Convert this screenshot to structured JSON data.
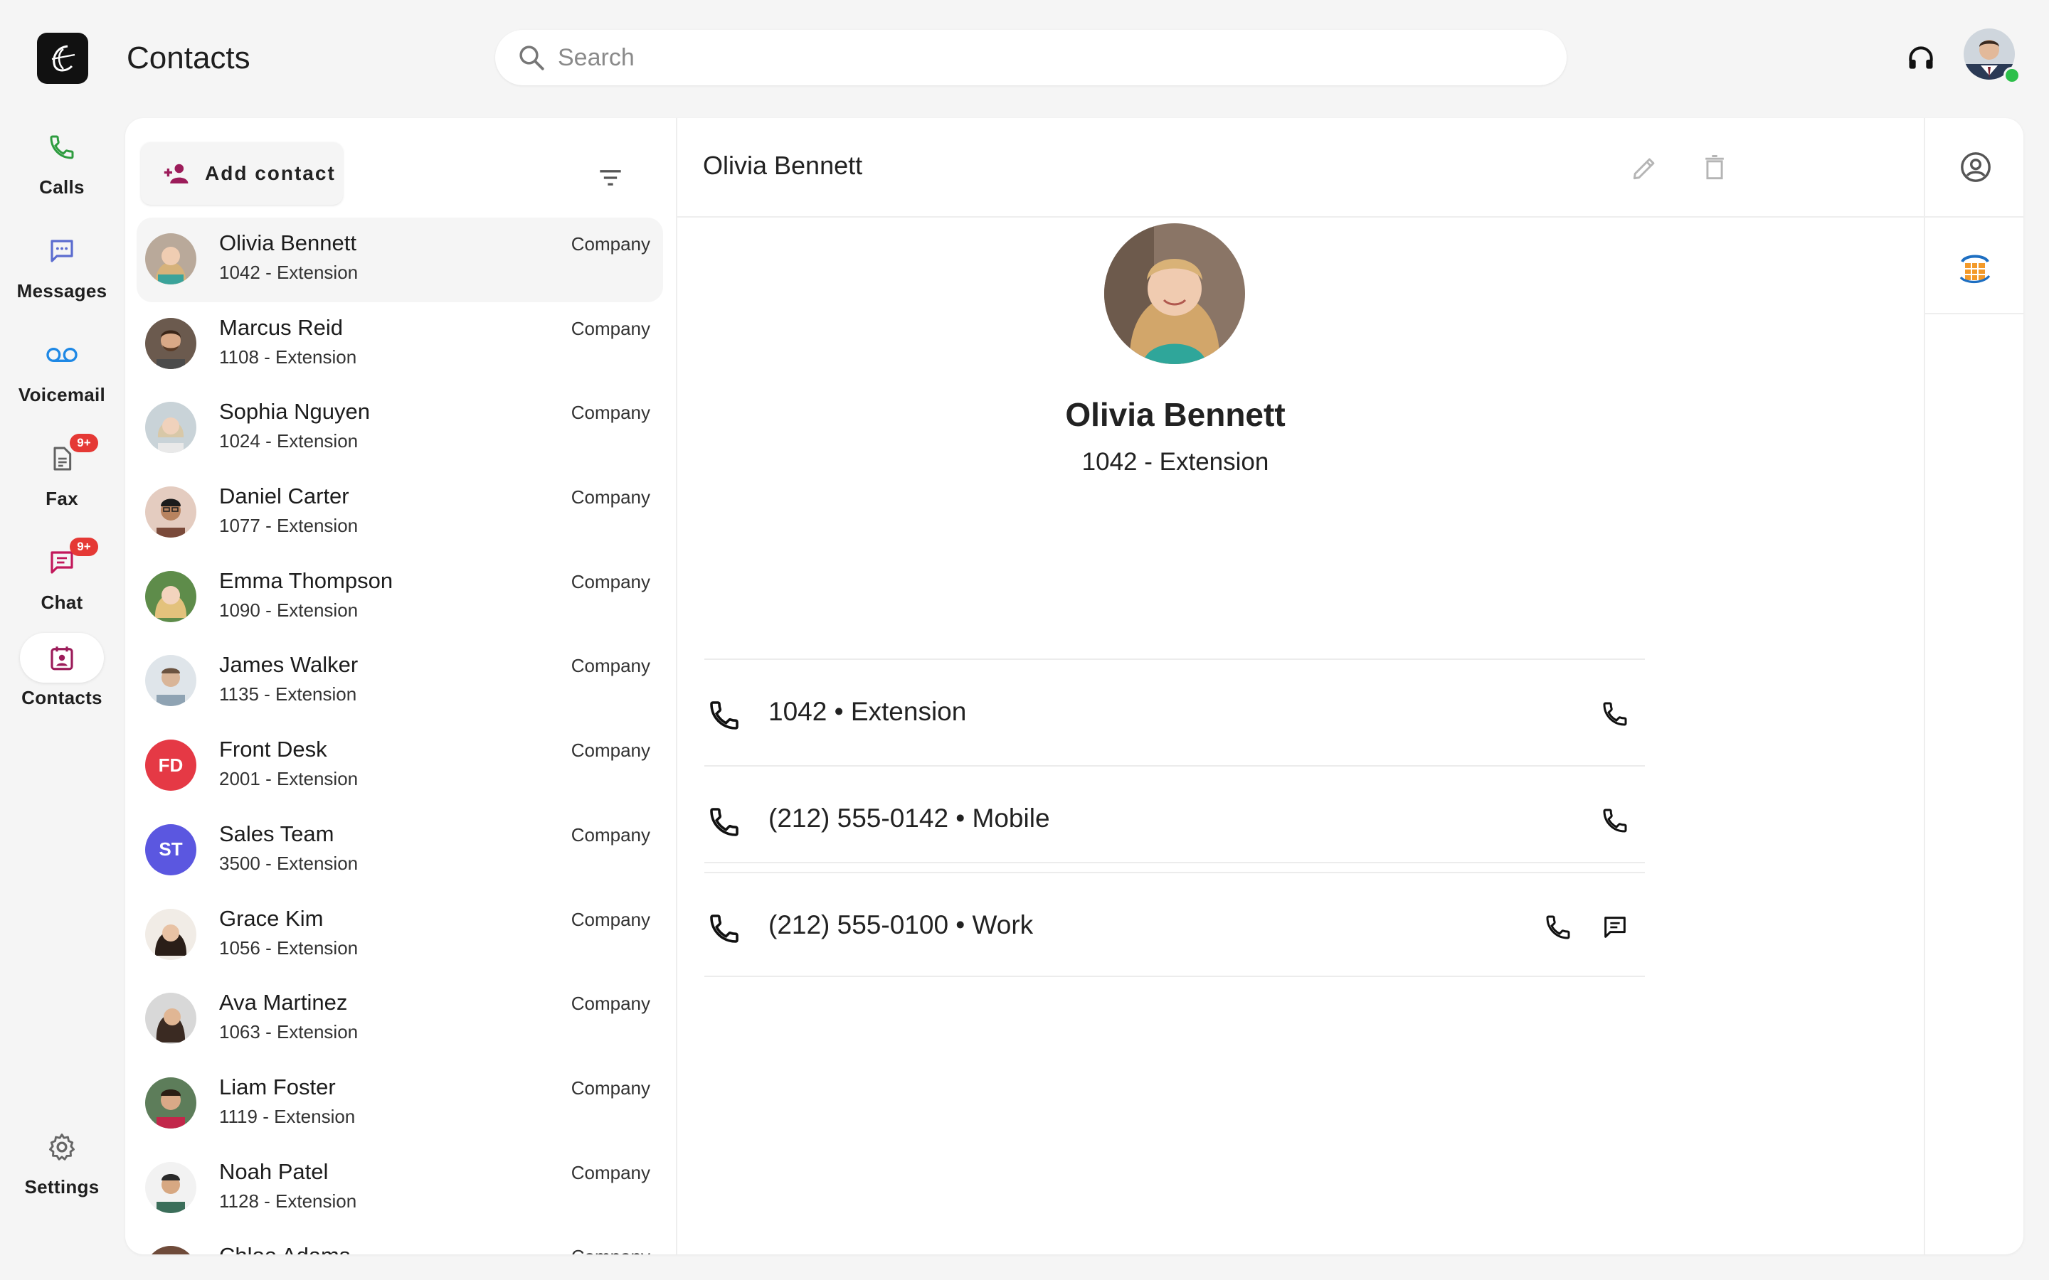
{
  "app": {
    "title": "Contacts"
  },
  "search": {
    "placeholder": "Search"
  },
  "nav": [
    {
      "label": "Calls",
      "icon": "phone-icon",
      "color": "#2e9c3f"
    },
    {
      "label": "Messages",
      "icon": "message-icon",
      "color": "#5b6ccf"
    },
    {
      "label": "Voicemail",
      "icon": "voicemail-icon",
      "color": "#1e88e5"
    },
    {
      "label": "Fax",
      "icon": "fax-icon",
      "color": "#616161",
      "badge": "9+"
    },
    {
      "label": "Chat",
      "icon": "chat-icon",
      "color": "#c2185b",
      "badge": "9+"
    },
    {
      "label": "Contacts",
      "icon": "contacts-icon",
      "color": "#9c1c5a",
      "active": true
    }
  ],
  "settings": {
    "label": "Settings"
  },
  "list": {
    "add_label": "Add contact",
    "contacts": [
      {
        "name": "Olivia Bennett",
        "ext": "1042 - Extension",
        "company": "Company",
        "selected": true
      },
      {
        "name": "Marcus Reid",
        "ext": "1108 - Extension",
        "company": "Company"
      },
      {
        "name": "Sophia Nguyen",
        "ext": "1024 - Extension",
        "company": "Company"
      },
      {
        "name": "Daniel Carter",
        "ext": "1077 - Extension",
        "company": "Company"
      },
      {
        "name": "Emma Thompson",
        "ext": "1090 - Extension",
        "company": "Company"
      },
      {
        "name": "James Walker",
        "ext": "1135 - Extension",
        "company": "Company"
      },
      {
        "name": "Front Desk",
        "ext": "2001 - Extension",
        "company": "Company",
        "initials": "FD",
        "color": "#e53945"
      },
      {
        "name": "Sales Team",
        "ext": "3500 - Extension",
        "company": "Company",
        "initials": "ST",
        "color": "#5b57e0"
      },
      {
        "name": "Grace Kim",
        "ext": "1056 - Extension",
        "company": "Company"
      },
      {
        "name": "Ava Martinez",
        "ext": "1063 - Extension",
        "company": "Company"
      },
      {
        "name": "Liam Foster",
        "ext": "1119 - Extension",
        "company": "Company"
      },
      {
        "name": "Noah Patel",
        "ext": "1128 - Extension",
        "company": "Company"
      },
      {
        "name": "Chloe Adams",
        "ext": "",
        "company": "Company"
      }
    ]
  },
  "detail": {
    "header_name": "Olivia Bennett",
    "name": "Olivia Bennett",
    "subtitle": "1042 - Extension",
    "numbers": [
      {
        "text": "1042 • Extension",
        "actions": [
          "call"
        ]
      },
      {
        "text": "(212) 555-0142 • Mobile",
        "actions": [
          "call"
        ]
      },
      {
        "text": "(212) 555-0100 • Work",
        "actions": [
          "call",
          "message"
        ]
      }
    ]
  }
}
